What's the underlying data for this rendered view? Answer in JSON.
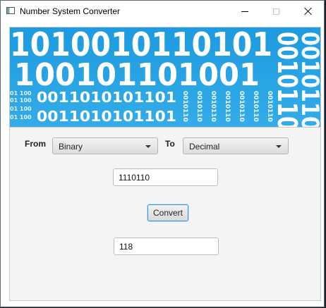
{
  "window": {
    "title": "Number System Converter",
    "icon": "app-window-icon"
  },
  "banner": {
    "rows": [
      "1010010110101",
      "100101101001",
      "0011010101101",
      "0011010101101"
    ],
    "side_left": "01 100",
    "side_vertical": "0010110",
    "colors": {
      "background": "#2aa3e2",
      "digits": "#ffffff"
    }
  },
  "converter": {
    "from_label": "From",
    "to_label": "To",
    "from_selected": "Binary",
    "to_selected": "Decimal",
    "input_value": "1110110",
    "convert_label": "Convert",
    "output_value": "118"
  },
  "colors": {
    "panel": "#f4f4f4",
    "focus_border": "#3d95cf"
  }
}
